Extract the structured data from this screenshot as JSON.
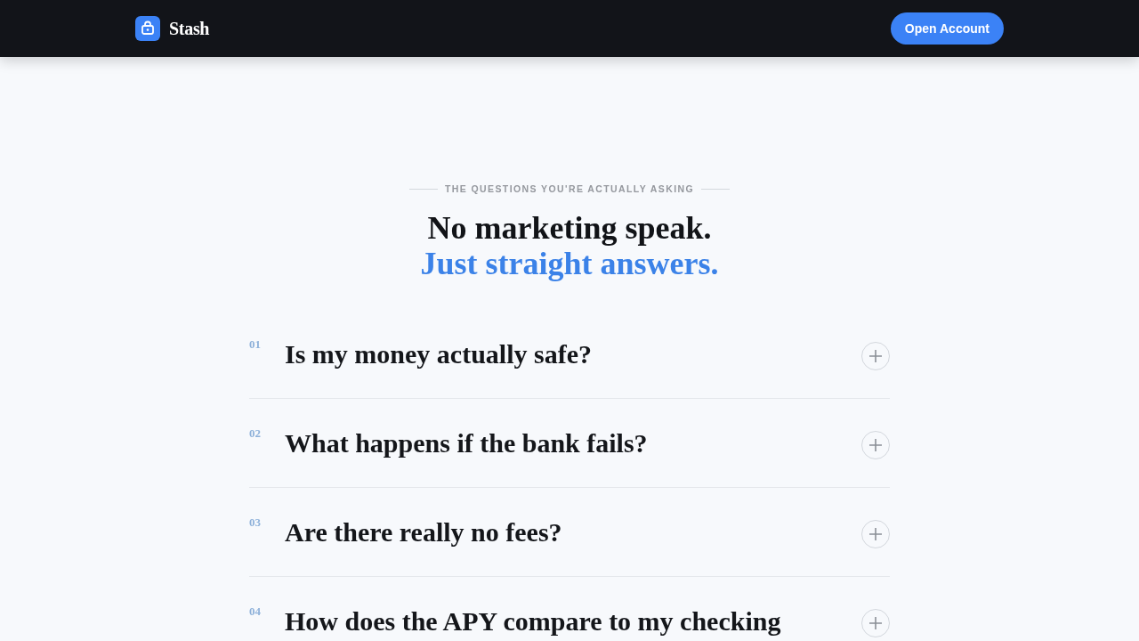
{
  "nav": {
    "brand": "Stash",
    "cta": "Open Account"
  },
  "header": {
    "eyebrow": "THE QUESTIONS YOU'RE ACTUALLY ASKING",
    "title": "No marketing speak.",
    "title_accent": "Just straight answers."
  },
  "faq": [
    {
      "number": "01",
      "question": "Is my money actually safe?",
      "expanded": false
    },
    {
      "number": "02",
      "question": "What happens if the bank fails?",
      "expanded": false
    },
    {
      "number": "03",
      "question": "Are there really no fees?",
      "expanded": false
    },
    {
      "number": "04",
      "question": "How does the APY compare to my checking",
      "expanded": false
    }
  ]
}
